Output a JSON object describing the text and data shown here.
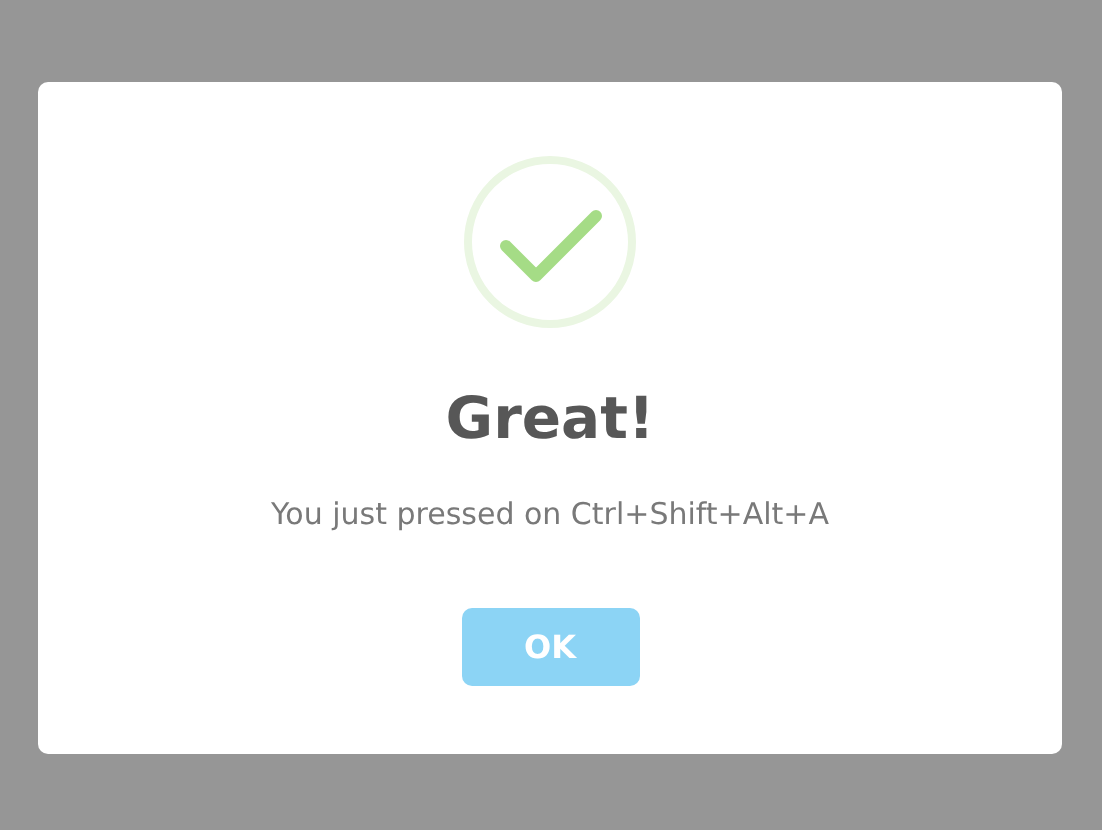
{
  "dialog": {
    "kind": "success",
    "title": "Great!",
    "message": "You just pressed on Ctrl+Shift+Alt+A",
    "button": "OK"
  }
}
